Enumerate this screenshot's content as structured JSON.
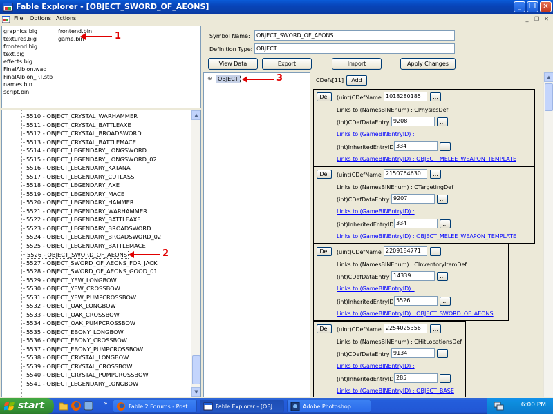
{
  "window": {
    "title": "Fable Explorer - [OBJECT_SWORD_OF_AEONS]"
  },
  "menu": {
    "items": [
      "File",
      "Options",
      "Actions"
    ]
  },
  "files": {
    "col1": [
      "graphics.big",
      "textures.big",
      "frontend.big",
      "text.big",
      "effects.big",
      "FinalAlbion.wad",
      "FinalAlbion_RT.stb",
      "names.bin",
      "script.bin"
    ],
    "col2": [
      "frontend.bin",
      "game.bin"
    ],
    "selected": "game.bin"
  },
  "symbols": [
    "5510 - OBJECT_CRYSTAL_WARHAMMER",
    "5511 - OBJECT_CRYSTAL_BATTLEAXE",
    "5512 - OBJECT_CRYSTAL_BROADSWORD",
    "5513 - OBJECT_CRYSTAL_BATTLEMACE",
    "5514 - OBJECT_LEGENDARY_LONGSWORD",
    "5515 - OBJECT_LEGENDARY_LONGSWORD_02",
    "5516 - OBJECT_LEGENDARY_KATANA",
    "5517 - OBJECT_LEGENDARY_CUTLASS",
    "5518 - OBJECT_LEGENDARY_AXE",
    "5519 - OBJECT_LEGENDARY_MACE",
    "5520 - OBJECT_LEGENDARY_HAMMER",
    "5521 - OBJECT_LEGENDARY_WARHAMMER",
    "5522 - OBJECT_LEGENDARY_BATTLEAXE",
    "5523 - OBJECT_LEGENDARY_BROADSWORD",
    "5524 - OBJECT_LEGENDARY_BROADSWORD_02",
    "5525 - OBJECT_LEGENDARY_BATTLEMACE",
    "5526 - OBJECT_SWORD_OF_AEONS",
    "5527 - OBJECT_SWORD_OF_AEONS_FOR_JACK",
    "5528 - OBJECT_SWORD_OF_AEONS_GOOD_01",
    "5529 - OBJECT_YEW_LONGBOW",
    "5530 - OBJECT_YEW_CROSSBOW",
    "5531 - OBJECT_YEW_PUMPCROSSBOW",
    "5532 - OBJECT_OAK_LONGBOW",
    "5533 - OBJECT_OAK_CROSSBOW",
    "5534 - OBJECT_OAK_PUMPCROSSBOW",
    "5535 - OBJECT_EBONY_LONGBOW",
    "5536 - OBJECT_EBONY_CROSSBOW",
    "5537 - OBJECT_EBONY_PUMPCROSSBOW",
    "5538 - OBJECT_CRYSTAL_LONGBOW",
    "5539 - OBJECT_CRYSTAL_CROSSBOW",
    "5540 - OBJECT_CRYSTAL_PUMPCROSSBOW",
    "5541 - OBJECT_LEGENDARY_LONGBOW"
  ],
  "selected_symbol": "5526 - OBJECT_SWORD_OF_AEONS",
  "form": {
    "symbol_name_label": "Symbol Name:",
    "symbol_name": "OBJECT_SWORD_OF_AEONS",
    "def_type_label": "Definition Type:",
    "def_type": "OBJECT",
    "buttons": {
      "view_data": "View Data",
      "export": "Export",
      "import": "Import",
      "apply": "Apply Changes"
    }
  },
  "tree": {
    "expander": "⊕",
    "root": "OBJECT"
  },
  "cdefs": {
    "header": "CDefs[11]",
    "add": "Add",
    "del": "Del",
    "more": "...",
    "labels": {
      "cdef_name": "(uint)CDefName",
      "links_to_names": "Links to (NamesBINEnum) : ",
      "data_entry": "(int)CDefDataEntry",
      "links_to_game": "Links to (GameBINEntryID) :",
      "inherited": "(int)InheritedEntryID",
      "links_to_game_prefix": "Links to (GameBINEntryID) : "
    },
    "items": [
      {
        "name": "1018280185",
        "enum": "CPhysicsDef",
        "data": "9208",
        "inherited": "334",
        "target": "OBJECT_MELEE_WEAPON_TEMPLATE"
      },
      {
        "name": "2150764630",
        "enum": "CTargetingDef",
        "data": "9207",
        "inherited": "334",
        "target": "OBJECT_MELEE_WEAPON_TEMPLATE"
      },
      {
        "name": "2209184771",
        "enum": "CInventoryItemDef",
        "data": "14339",
        "inherited": "5526",
        "target": "OBJECT_SWORD_OF_AEONS"
      },
      {
        "name": "2254025356",
        "enum": "CHitLocationsDef",
        "data": "9134",
        "inherited": "285",
        "target": "OBJECT_BASE"
      }
    ]
  },
  "annotations": [
    "1",
    "2",
    "3"
  ],
  "taskbar": {
    "start": "start",
    "tasks": [
      "Fable 2 Forums - Post...",
      "Fable Explorer - [OBJ...",
      "Adobe Photoshop"
    ],
    "clock": "6:00 PM"
  },
  "colors": {
    "titlebar": "#0a5bd8",
    "taskbar": "#245edc",
    "start": "#3c9c3c",
    "annotation": "#e00000",
    "link": "#0000ff"
  }
}
